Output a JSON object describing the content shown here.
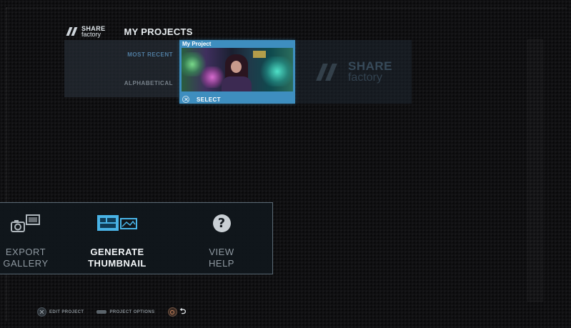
{
  "app": {
    "logo_line1": "SHARE",
    "logo_line2": "factory"
  },
  "header": {
    "title": "MY PROJECTS"
  },
  "sort_options": {
    "most_recent": "MOST RECENT",
    "alphabetical": "ALPHABETICAL",
    "selected": "MOST RECENT"
  },
  "projects": [
    {
      "title": "My Project",
      "action_label": "SELECT",
      "selected": true
    }
  ],
  "placeholder": {
    "logo_line1": "SHARE",
    "logo_line2": "factory"
  },
  "actions": [
    {
      "line1": "EXPORT",
      "line2": "GALLERY",
      "icon": "camera-export-icon",
      "active": false
    },
    {
      "line1": "GENERATE",
      "line2": "THUMBNAIL",
      "icon": "thumbnail-icon",
      "active": true
    },
    {
      "line1": "VIEW",
      "line2": "HELP",
      "icon": "help-icon",
      "icon_glyph": "?",
      "active": false
    }
  ],
  "footer": {
    "edit_project": "EDIT PROJECT",
    "project_options": "PROJECT OPTIONS",
    "back_glyph": "⮌"
  },
  "colors": {
    "accent": "#3e8ebf",
    "active_sort": "#4f7ca0",
    "thumbnail_icon": "#49b3e6",
    "panel_border": "#5a6974"
  }
}
